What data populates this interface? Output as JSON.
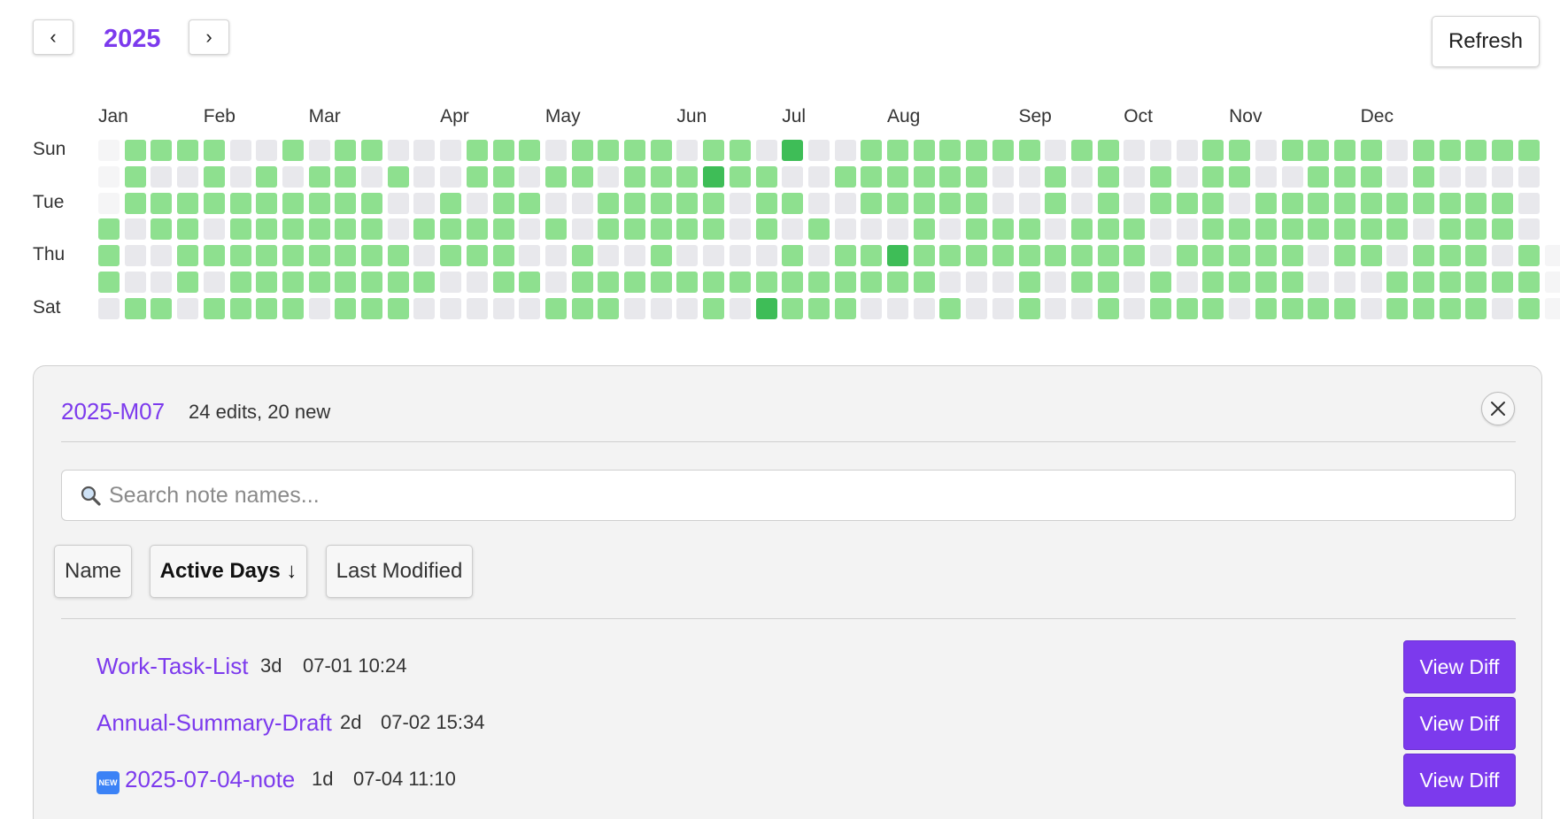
{
  "header": {
    "prev_label": "‹",
    "next_label": "›",
    "year": "2025",
    "refresh_label": "Refresh"
  },
  "heatmap": {
    "months": [
      "Jan",
      "Feb",
      "Mar",
      "Apr",
      "May",
      "Jun",
      "Jul",
      "Aug",
      "Sep",
      "Oct",
      "Nov",
      "Dec"
    ],
    "month_start_weeks": [
      0,
      4,
      8,
      13,
      17,
      22,
      26,
      30,
      35,
      39,
      43,
      48
    ],
    "day_labels": [
      "Sun",
      "",
      "Tue",
      "",
      "Thu",
      "",
      "Sat"
    ],
    "colors": {
      "empty": "#e8e8ec",
      "low": "#8ee08f",
      "high": "#3ebd57",
      "out_of_year": "#f5f5f6"
    },
    "activity": [
      "f111100101100011101111011020011111110110001101111011111",
      "f100101011010011011011121100111111001010101100111010000",
      "f111111111100101100111110110011111001010111011111111110",
      "1011011111101111010111110101000101110111001111111101110",
      "1001111111110111001001000010112111111111011111011011101f",
      "1001011111111001101111111111111100010110101111000111111f",
      "0110111101110000011100010211100010010010111011110111101f"
    ]
  },
  "panel": {
    "month": "2025-M07",
    "stats": "24 edits, 20 new",
    "search_placeholder": "Search note names...",
    "search_icon": "magnifier-icon",
    "close_icon": "close-icon",
    "sort_buttons": [
      {
        "label": "Name",
        "active": false
      },
      {
        "label": "Active Days ↓",
        "active": true
      },
      {
        "label": "Last Modified",
        "active": false
      }
    ],
    "notes": [
      {
        "name": "Work-Task-List",
        "days": "3d",
        "modified": "07-01 10:24",
        "is_new": false,
        "action": "View Diff"
      },
      {
        "name": "Annual-Summary-Draft",
        "days": "2d",
        "modified": "07-02 15:34",
        "is_new": false,
        "action": "View Diff"
      },
      {
        "name": "2025-07-04-note",
        "days": "1d",
        "modified": "07-04 11:10",
        "is_new": true,
        "new_badge": "NEW",
        "action": "View Diff"
      }
    ]
  }
}
